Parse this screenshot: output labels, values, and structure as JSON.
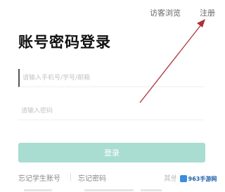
{
  "header": {
    "guest_label": "访客浏览",
    "register_label": "注册"
  },
  "title": "账号密码登录",
  "form": {
    "account_placeholder": "请输入手机号/学号/邮箱",
    "password_placeholder": "请输入密码",
    "login_label": "登录"
  },
  "footer": {
    "forgot_student": "忘记学生账号",
    "forgot_password": "忘记密码",
    "more": "其他"
  },
  "watermark": {
    "text": "963手游网"
  },
  "colors": {
    "accent": "#a9ddd1",
    "arrow": "#b0303a"
  }
}
